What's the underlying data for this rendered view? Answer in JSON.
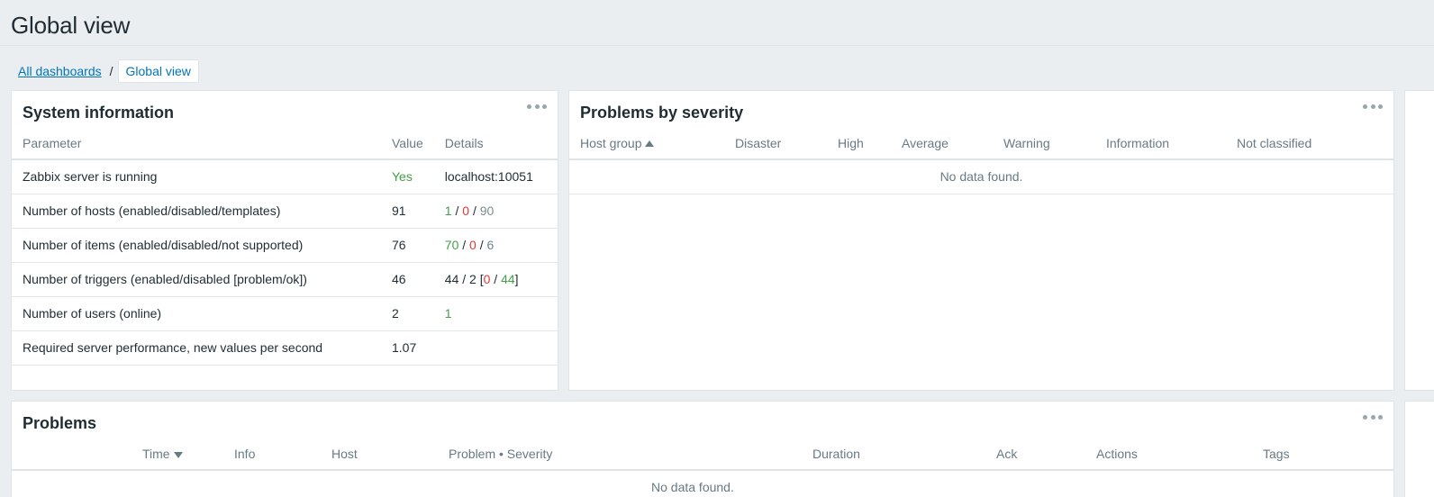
{
  "page": {
    "title": "Global view"
  },
  "breadcrumb": {
    "all_dashboards": "All dashboards",
    "separator": "/",
    "current": "Global view"
  },
  "system_info": {
    "title": "System information",
    "columns": [
      "Parameter",
      "Value",
      "Details"
    ],
    "rows": [
      {
        "param": "Zabbix server is running",
        "value": "Yes",
        "details": "localhost:10051"
      },
      {
        "param": "Number of hosts (enabled/disabled/templates)",
        "value": "91",
        "d1": "1",
        "d2": "0",
        "d3": "90",
        "sep": "/"
      },
      {
        "param": "Number of items (enabled/disabled/not supported)",
        "value": "76",
        "d1": "70",
        "d2": "0",
        "d3": "6",
        "sep": "/"
      },
      {
        "param": "Number of triggers (enabled/disabled [problem/ok])",
        "value": "46",
        "d_prefix": "44 / 2 [",
        "d1": "0",
        "sep": " / ",
        "d2": "44",
        "d_suffix": "]"
      },
      {
        "param": "Number of users (online)",
        "value": "2",
        "details": "1"
      },
      {
        "param": "Required server performance, new values per second",
        "value": "1.07",
        "details": ""
      }
    ]
  },
  "problems_by_severity": {
    "title": "Problems by severity",
    "columns": [
      "Host group",
      "Disaster",
      "High",
      "Average",
      "Warning",
      "Information",
      "Not classified"
    ],
    "empty": "No data found."
  },
  "problems": {
    "title": "Problems",
    "columns": [
      "Time",
      "Info",
      "Host",
      "Problem • Severity",
      "Duration",
      "Ack",
      "Actions",
      "Tags"
    ],
    "empty": "No data found."
  },
  "colors": {
    "ok_green": "#429e47",
    "bad_red": "#e33734",
    "link_blue": "#0275b8"
  }
}
